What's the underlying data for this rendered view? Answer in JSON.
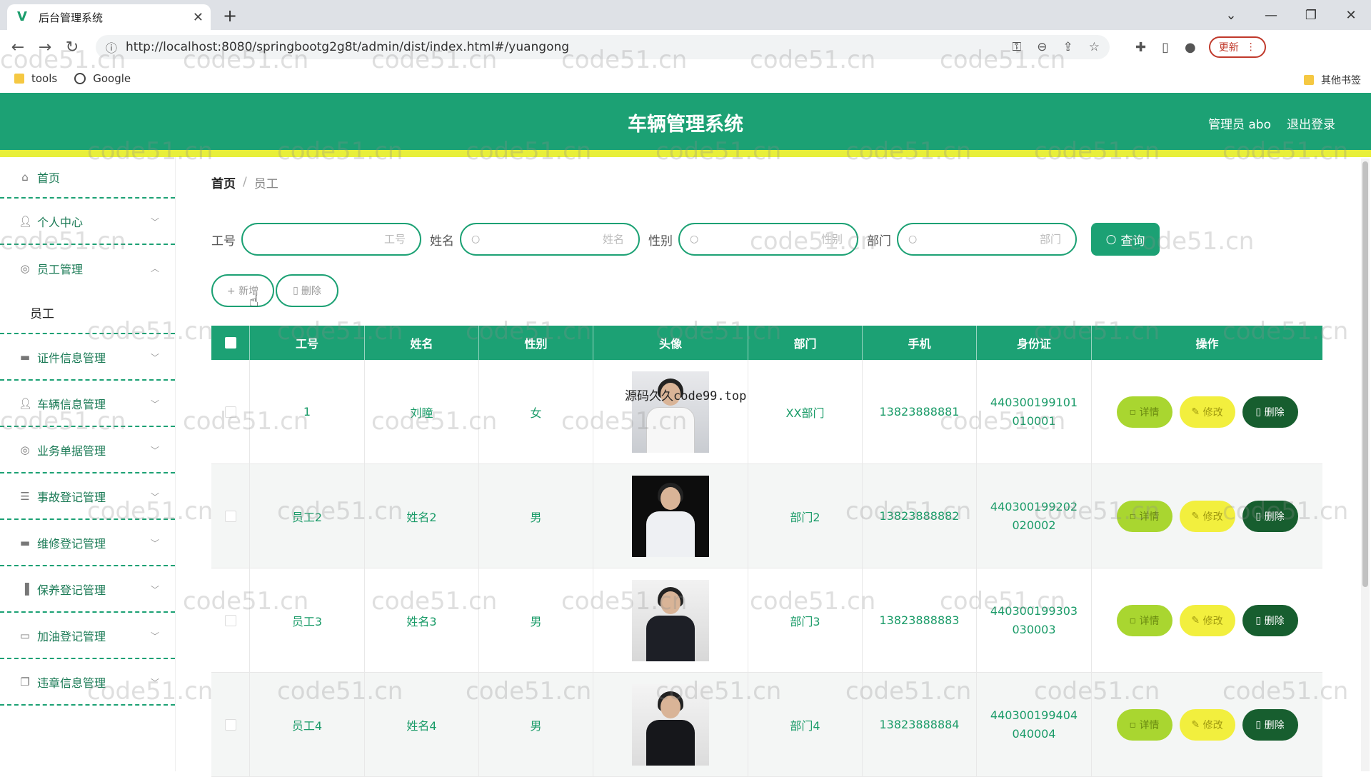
{
  "browser": {
    "tab_title": "后台管理系统",
    "url": "http://localhost:8080/springbootg2g8t/admin/dist/index.html#/yuangong",
    "update_label": "更新",
    "bookmarks": [
      "tools",
      "Google"
    ],
    "other_bookmarks": "其他书签"
  },
  "header": {
    "title": "车辆管理系统",
    "user": "管理员 abo",
    "logout": "退出登录"
  },
  "sidebar": {
    "items": [
      {
        "label": "首页",
        "icon": "home-icon"
      },
      {
        "label": "个人中心",
        "icon": "user-icon"
      },
      {
        "label": "员工管理",
        "icon": "compass-icon"
      },
      {
        "label": "证件信息管理",
        "icon": "printer-icon"
      },
      {
        "label": "车辆信息管理",
        "icon": "user-icon"
      },
      {
        "label": "业务单据管理",
        "icon": "compass-icon"
      },
      {
        "label": "事故登记管理",
        "icon": "sliders-icon"
      },
      {
        "label": "维修登记管理",
        "icon": "printer-icon"
      },
      {
        "label": "保养登记管理",
        "icon": "bar-chart-icon"
      },
      {
        "label": "加油登记管理",
        "icon": "chat-icon"
      },
      {
        "label": "违章信息管理",
        "icon": "copy-icon"
      }
    ],
    "submenu": "员工"
  },
  "breadcrumb": {
    "home": "首页",
    "sep": "/",
    "current": "员工"
  },
  "search": {
    "fields": [
      {
        "label": "工号",
        "placeholder": "工号"
      },
      {
        "label": "姓名",
        "placeholder": "姓名"
      },
      {
        "label": "性别",
        "placeholder": "性别"
      },
      {
        "label": "部门",
        "placeholder": "部门"
      }
    ],
    "query_button": "查询"
  },
  "actions": {
    "add": "+ 新增",
    "delete": "删除"
  },
  "table": {
    "columns": [
      "工号",
      "姓名",
      "性别",
      "头像",
      "部门",
      "手机",
      "身份证",
      "操作"
    ],
    "rows": [
      {
        "id": "1",
        "name": "刘瞳",
        "gender": "女",
        "dept": "XX部门",
        "phone": "13823888881",
        "idcard": "440300199101010001"
      },
      {
        "id": "员工2",
        "name": "姓名2",
        "gender": "男",
        "dept": "部门2",
        "phone": "13823888882",
        "idcard": "440300199202020002"
      },
      {
        "id": "员工3",
        "name": "姓名3",
        "gender": "男",
        "dept": "部门3",
        "phone": "13823888883",
        "idcard": "440300199303030003"
      },
      {
        "id": "员工4",
        "name": "姓名4",
        "gender": "男",
        "dept": "部门4",
        "phone": "13823888884",
        "idcard": "440300199404040004"
      }
    ],
    "op_detail": "详情",
    "op_edit": "修改",
    "op_delete": "删除"
  },
  "overlay_text": "源码久久code99.top",
  "watermark": "code51.cn",
  "colors": {
    "primary": "#1ca174",
    "accent_yellow": "#e8ef3a",
    "detail": "#a9d630",
    "edit": "#f2ef3e",
    "delete": "#175e2f"
  }
}
